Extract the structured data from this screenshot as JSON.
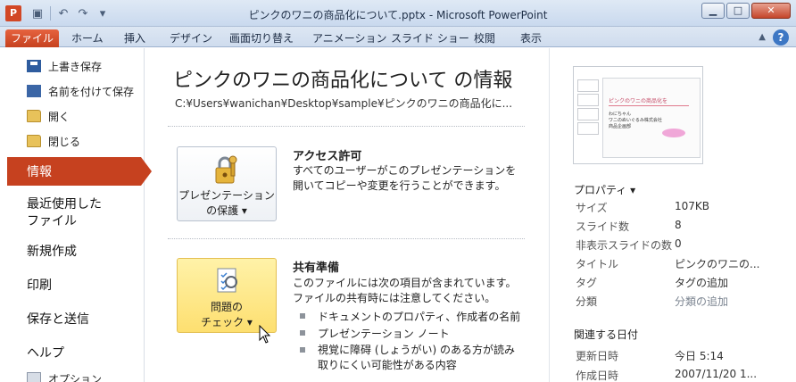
{
  "window": {
    "title": "ピンクのワニの商品化について.pptx - Microsoft PowerPoint",
    "app_icon_letter": "P",
    "buttons": {
      "minimize": "▁",
      "maximize": "□",
      "close": "✕"
    }
  },
  "quick_access": {
    "save_icon": "save-icon",
    "undo_icon": "undo-icon",
    "redo_icon": "redo-icon"
  },
  "tabs": [
    "ファイル",
    "ホーム",
    "挿入",
    "デザイン",
    "画面切り替え",
    "アニメーション",
    "スライド ショー",
    "校閲",
    "表示"
  ],
  "help": "?",
  "left_menu": {
    "save": "上書き保存",
    "save_as": "名前を付けて保存",
    "open": "開く",
    "close": "閉じる",
    "info": "情報",
    "recent_1": "最近使用した",
    "recent_2": "ファイル",
    "new": "新規作成",
    "print": "印刷",
    "save_send": "保存と送信",
    "help": "ヘルプ",
    "options": "オプション"
  },
  "main": {
    "title": "ピンクのワニの商品化について の情報",
    "path": "C:¥Users¥wanichan¥Desktop¥sample¥ピンクのワニの商品化に...",
    "protect": {
      "button_line1": "プレゼンテーション",
      "button_line2": "の保護 ▾",
      "heading": "アクセス許可",
      "text": "すべてのユーザーがこのプレゼンテーションを開いてコピーや変更を行うことができます。"
    },
    "check": {
      "button_line1": "問題の",
      "button_line2": "チェック ▾",
      "heading": "共有準備",
      "text": "このファイルには次の項目が含まれています。ファイルの共有時には注意してください。",
      "bullets": [
        "ドキュメントのプロパティ、作成者の名前",
        "プレゼンテーション ノート",
        "視覚に障碍 (しょうがい) のある方が読み取りにくい可能性がある内容"
      ]
    }
  },
  "thumbnail": {
    "slide_title": "ピンクのワニの商品化を",
    "slide_sub1": "わにちゃん",
    "slide_sub2": "ワニのぬいぐるみ株式会社",
    "slide_sub3": "商品企画部"
  },
  "properties": {
    "heading": "プロパティ ▾",
    "rows": [
      {
        "key": "サイズ",
        "value": "107KB",
        "muted": false
      },
      {
        "key": "スライド数",
        "value": "8",
        "muted": false
      },
      {
        "key": "非表示スライドの数",
        "value": "0",
        "muted": false
      },
      {
        "key": "タイトル",
        "value": "ピンクのワニの...",
        "muted": false
      },
      {
        "key": "タグ",
        "value": "タグの追加",
        "muted": false
      },
      {
        "key": "分類",
        "value": "分類の追加",
        "muted": true
      }
    ]
  },
  "dates": {
    "heading": "関連する日付",
    "rows": [
      {
        "key": "更新日時",
        "value": "今日 5:14"
      },
      {
        "key": "作成日時",
        "value": "2007/11/20 1..."
      }
    ]
  },
  "colors": {
    "accent": "#c6411f",
    "check_button": "#fddf70"
  }
}
